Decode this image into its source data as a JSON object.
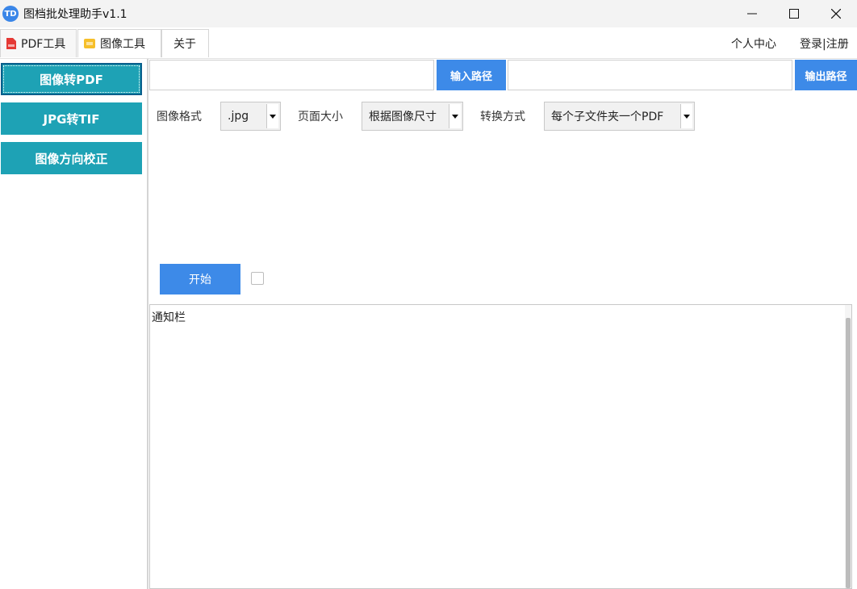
{
  "window": {
    "title": "图档批处理助手v1.1",
    "logo_text": "TD"
  },
  "tabs": [
    {
      "label": "PDF工具",
      "icon": "pdf-file-icon"
    },
    {
      "label": "图像工具",
      "icon": "image-file-icon"
    },
    {
      "label": "关于"
    }
  ],
  "top_links": {
    "profile": "个人中心",
    "login": "登录|注册"
  },
  "sidebar": {
    "items": [
      {
        "label": "图像转PDF"
      },
      {
        "label": "JPG转TIF"
      },
      {
        "label": "图像方向校正"
      }
    ]
  },
  "paths": {
    "input_value": "",
    "input_button": "输入路径",
    "output_value": "",
    "output_button": "输出路径"
  },
  "options": {
    "format_label": "图像格式",
    "format_value": ".jpg",
    "pagesize_label": "页面大小",
    "pagesize_value": "根据图像尺寸",
    "mode_label": "转换方式",
    "mode_value": "每个子文件夹一个PDF"
  },
  "actions": {
    "start_label": "开始"
  },
  "notice": {
    "title": "通知栏"
  },
  "colors": {
    "sidebar_button": "#1ea2b5",
    "primary_button": "#3d8ae8",
    "app_logo": "#3a86e8"
  }
}
